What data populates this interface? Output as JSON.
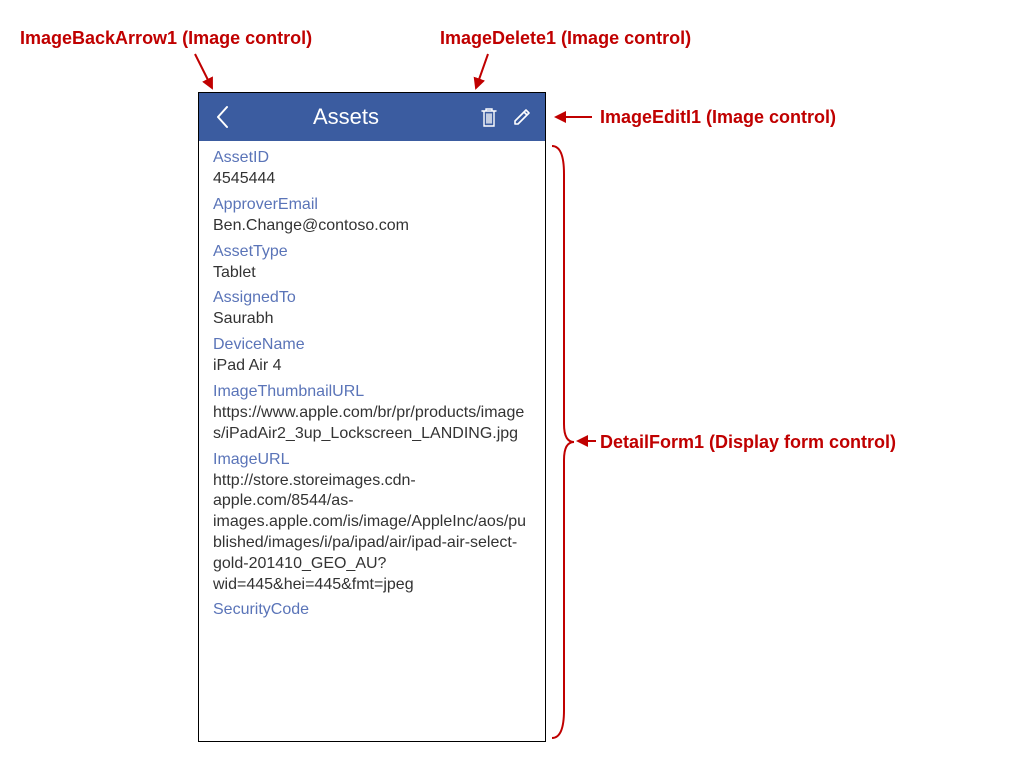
{
  "callouts": {
    "backArrow": "ImageBackArrow1 (Image control)",
    "delete": "ImageDelete1 (Image control)",
    "edit": "ImageEditI1 (Image control)",
    "detailForm": "DetailForm1 (Display form control)"
  },
  "header": {
    "title": "Assets"
  },
  "fields": [
    {
      "label": "AssetID",
      "value": "4545444"
    },
    {
      "label": "ApproverEmail",
      "value": "Ben.Change@contoso.com"
    },
    {
      "label": "AssetType",
      "value": "Tablet"
    },
    {
      "label": "AssignedTo",
      "value": "Saurabh"
    },
    {
      "label": "DeviceName",
      "value": "iPad Air 4"
    },
    {
      "label": "ImageThumbnailURL",
      "value": "https://www.apple.com/br/pr/products/images/iPadAir2_3up_Lockscreen_LANDING.jpg"
    },
    {
      "label": "ImageURL",
      "value": "http://store.storeimages.cdn-apple.com/8544/as-images.apple.com/is/image/AppleInc/aos/published/images/i/pa/ipad/air/ipad-air-select-gold-201410_GEO_AU?wid=445&hei=445&fmt=jpeg"
    },
    {
      "label": "SecurityCode",
      "value": ""
    }
  ]
}
